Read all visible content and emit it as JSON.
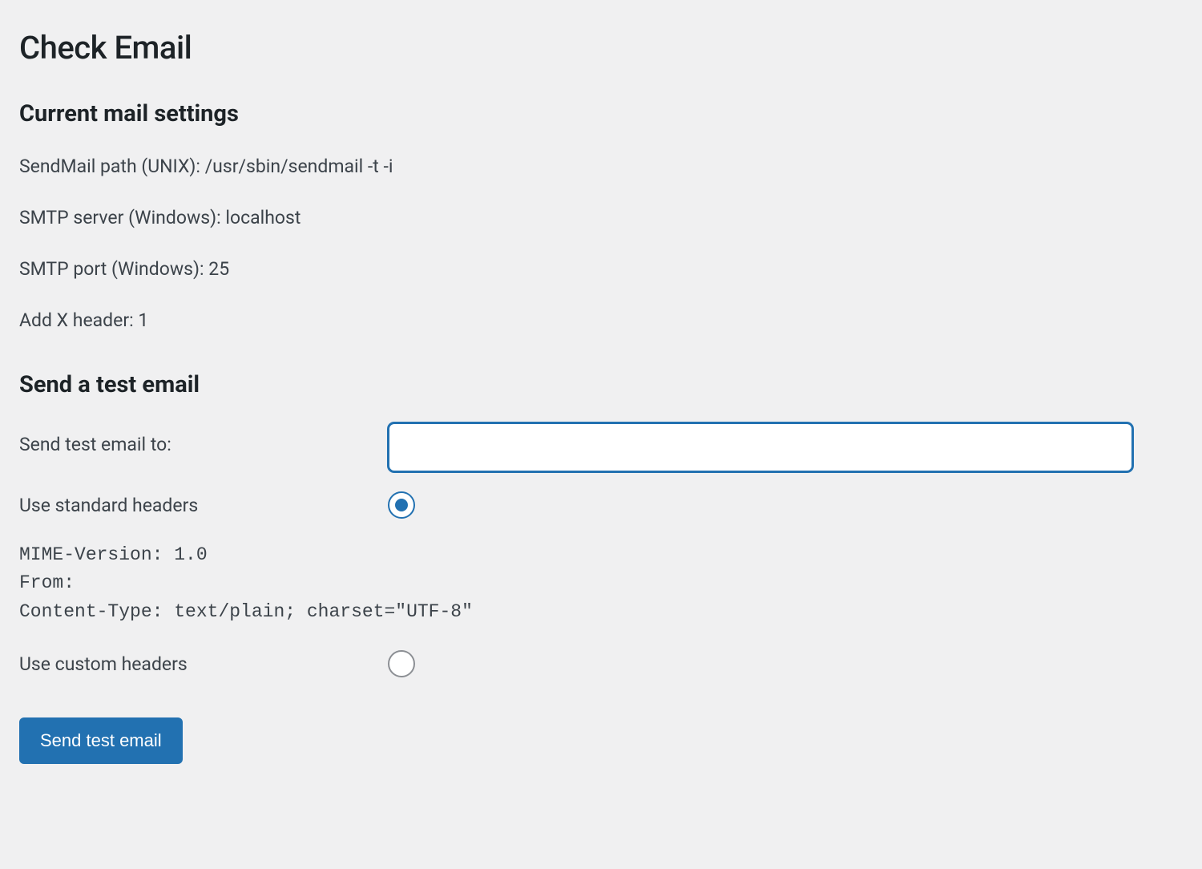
{
  "page": {
    "title": "Check Email"
  },
  "settings_section": {
    "heading": "Current mail settings",
    "sendmail_path": {
      "label": "SendMail path (UNIX): ",
      "value": "/usr/sbin/sendmail -t -i"
    },
    "smtp_server": {
      "label": "SMTP server (Windows): ",
      "value": "localhost"
    },
    "smtp_port": {
      "label": "SMTP port (Windows): ",
      "value": "25"
    },
    "add_x_header": {
      "label": "Add X header: ",
      "value": "1"
    }
  },
  "test_section": {
    "heading": "Send a test email",
    "send_to_label": "Send test email to:",
    "send_to_value": "",
    "use_standard_label": "Use standard headers",
    "use_standard_checked": true,
    "standard_headers_text": "MIME-Version: 1.0\nFrom:\nContent-Type: text/plain; charset=\"UTF-8\"",
    "use_custom_label": "Use custom headers",
    "use_custom_checked": false,
    "submit_label": "Send test email"
  }
}
